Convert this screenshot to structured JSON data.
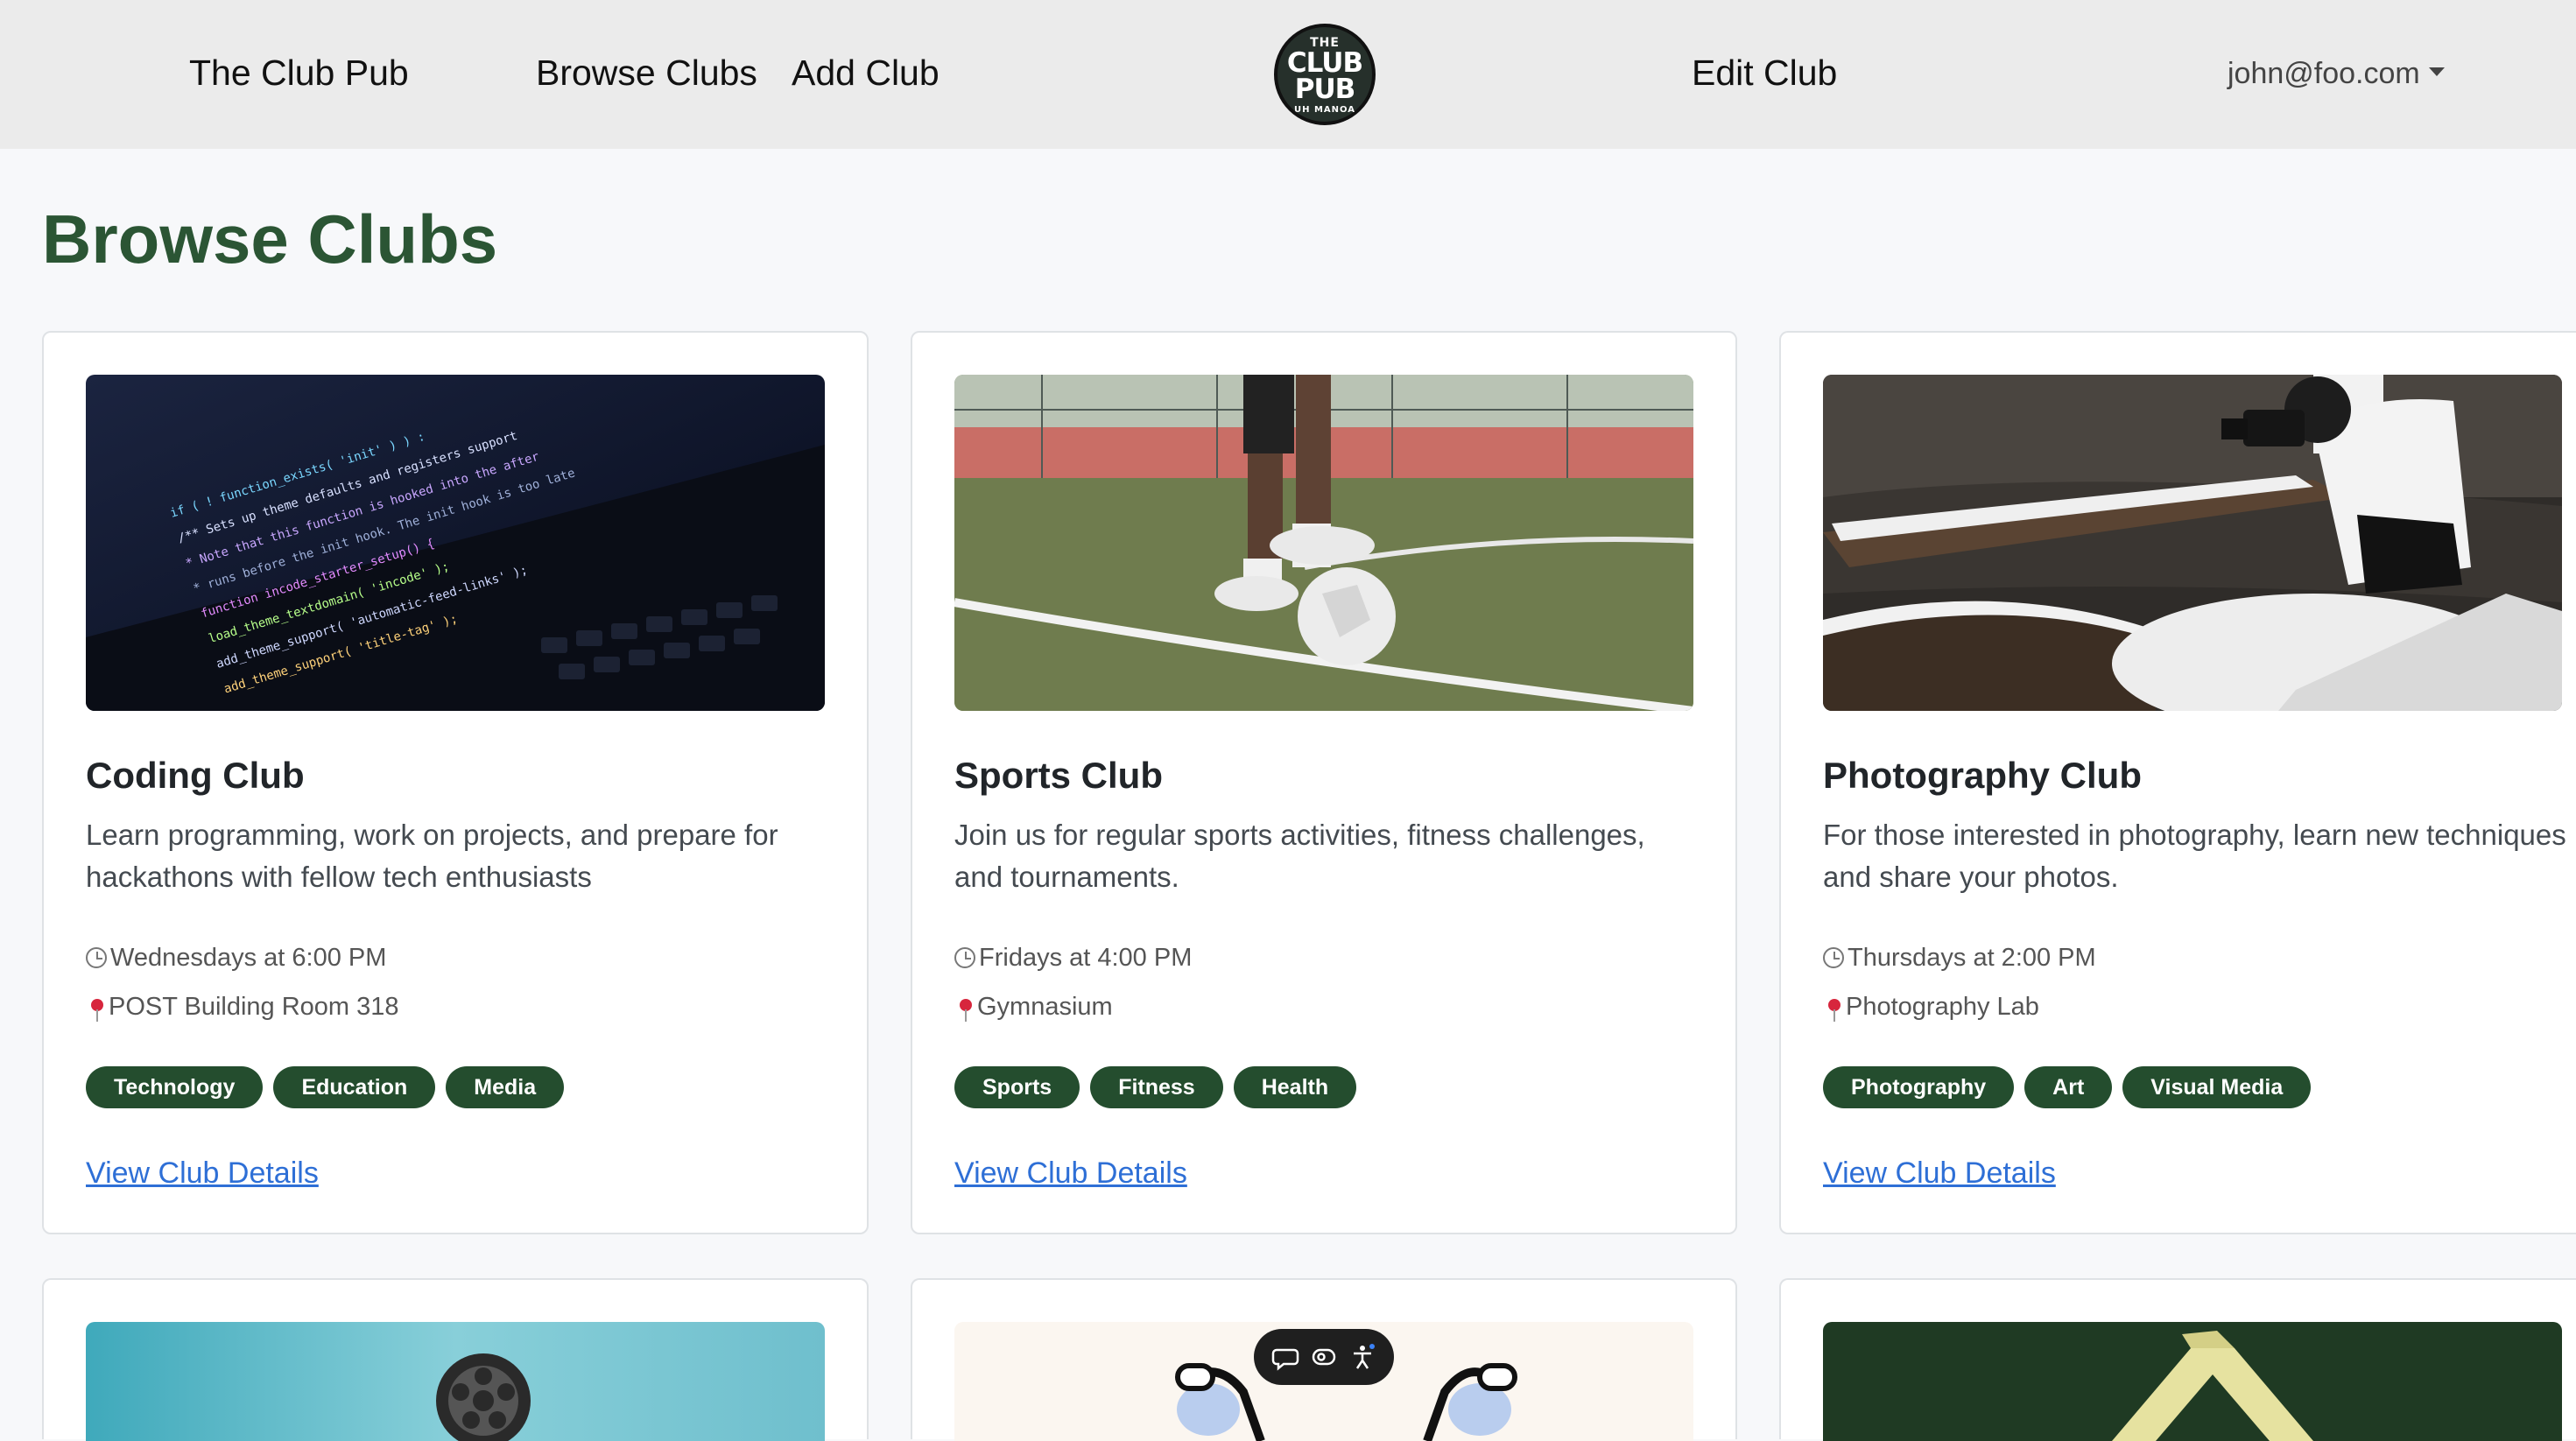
{
  "navbar": {
    "brand": "The Club Pub",
    "links": [
      "Browse Clubs",
      "Add Club",
      "Edit Club"
    ],
    "logo": {
      "line1": "THE",
      "line2": "CLUB",
      "line3": "PUB",
      "line4": "UH MANOA"
    },
    "user": "john@foo.com"
  },
  "page": {
    "title": "Browse Clubs"
  },
  "clubs": [
    {
      "name": "Coding Club",
      "description": "Learn programming, work on projects, and prepare for hackathons with fellow tech enthusiasts",
      "time": "Wednesdays at 6:00 PM",
      "location": "POST Building Room 318",
      "tags": [
        "Technology",
        "Education",
        "Media"
      ],
      "link": "View Club Details",
      "image": "laptop-code-photo"
    },
    {
      "name": "Sports Club",
      "description": "Join us for regular sports activities, fitness challenges, and tournaments.",
      "time": "Fridays at 4:00 PM",
      "location": "Gymnasium",
      "tags": [
        "Sports",
        "Fitness",
        "Health"
      ],
      "link": "View Club Details",
      "image": "soccer-field-photo"
    },
    {
      "name": "Photography Club",
      "description": "For those interested in photography, learn new techniques and share your photos.",
      "time": "Thursdays at 2:00 PM",
      "location": "Photography Lab",
      "tags": [
        "Photography",
        "Art",
        "Visual Media"
      ],
      "link": "View Club Details",
      "image": "photographer-snow-photo"
    }
  ],
  "colors": {
    "accent_green": "#244d2e",
    "title_green": "#2b5534",
    "link_blue": "#2e6fd6",
    "navbar_bg": "#ebebeb"
  },
  "floating_toolbar": {
    "icons": [
      "comment-icon",
      "view-icon",
      "accessibility-icon"
    ]
  }
}
